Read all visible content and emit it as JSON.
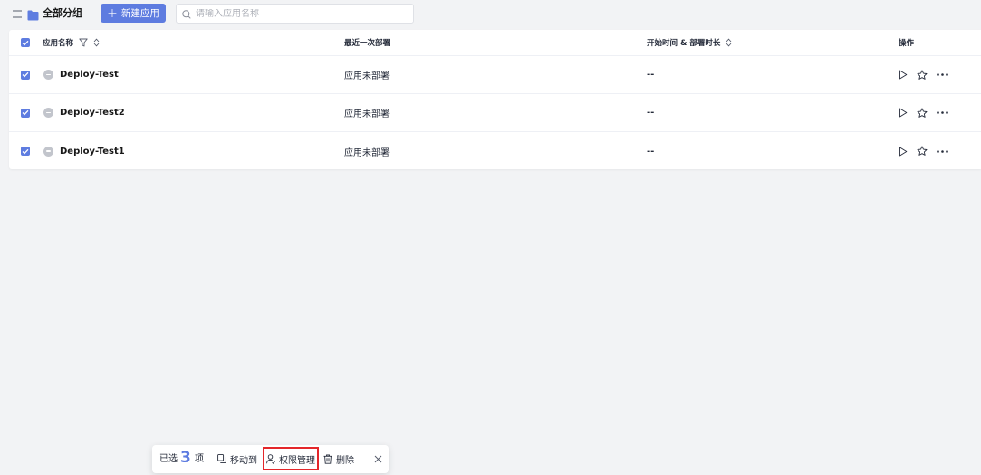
{
  "toolbar": {
    "group_title": "全部分组",
    "new_app_label": "新建应用",
    "search_placeholder": "请输入应用名称"
  },
  "table": {
    "columns": {
      "name": "应用名称",
      "last_deploy": "最近一次部署",
      "time": "开始时间 & 部署时长",
      "actions": "操作"
    },
    "rows": [
      {
        "name": "Deploy-Test",
        "last_deploy": "应用未部署",
        "time": "--"
      },
      {
        "name": "Deploy-Test2",
        "last_deploy": "应用未部署",
        "time": "--"
      },
      {
        "name": "Deploy-Test1",
        "last_deploy": "应用未部署",
        "time": "--"
      }
    ]
  },
  "selection_bar": {
    "prefix": "已选",
    "count": "3",
    "suffix": "项",
    "move_label": "移动到",
    "permission_label": "权限管理",
    "delete_label": "删除"
  },
  "colors": {
    "accent": "#5e7ce0",
    "highlight": "#e4262a",
    "status_grey": "#c2c5cc"
  },
  "icons": {
    "menu": "menu-icon",
    "folder": "folder-icon",
    "search": "search-icon",
    "filter": "filter-icon",
    "sort": "sort-icon",
    "play": "play-icon",
    "star": "star-icon",
    "more": "more-icon",
    "move": "copy-move-icon",
    "permission": "user-permission-icon",
    "delete": "trash-icon",
    "close": "close-icon"
  }
}
